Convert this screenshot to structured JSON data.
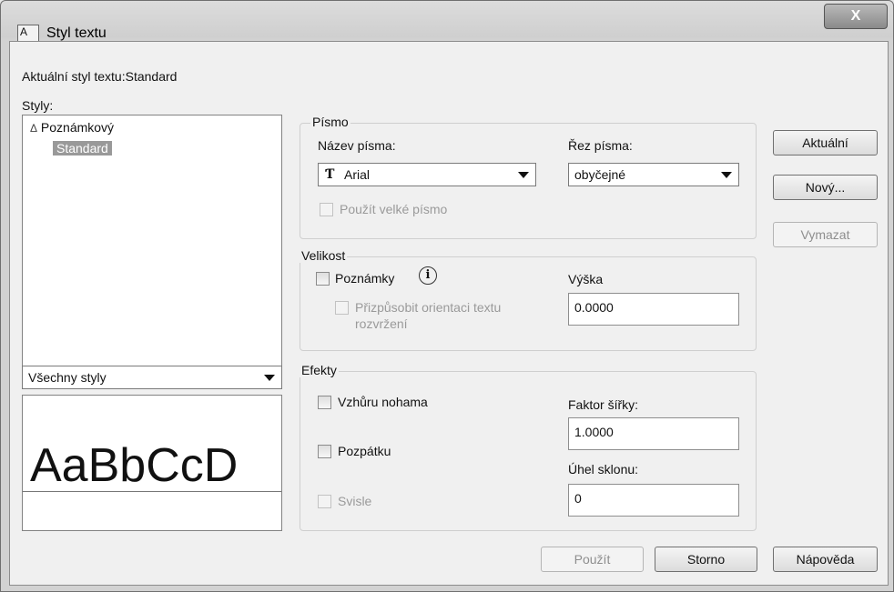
{
  "window": {
    "title": "Styl textu",
    "title_icon": "text-style-icon",
    "close_label": "X"
  },
  "current_style": {
    "label": "Aktuální styl textu:Standard"
  },
  "styles": {
    "label": "Styly:",
    "items": [
      {
        "icon": "annotative-icon",
        "icon_glyph": "Δ",
        "label": "Poznámkový",
        "selected": false
      },
      {
        "label": "Standard",
        "selected": true
      }
    ],
    "filter_value": "Všechny styly"
  },
  "preview": {
    "text": "AaBbCcD"
  },
  "font_group": {
    "title": "Písmo",
    "font_name_label": "Název písma:",
    "font_name_value": "Arial",
    "font_type_icon": "truetype-icon",
    "font_style_label": "Řez písma:",
    "font_style_value": "obyčejné",
    "big_font_label": "Použít velké písmo"
  },
  "size_group": {
    "title": "Velikost",
    "annotative_label": "Poznámky",
    "info_icon": "info-icon",
    "match_orientation_label_line1": "Přizpůsobit orientaci textu",
    "match_orientation_label_line2": "rozvržení",
    "height_label": "Výška",
    "height_value": "0.0000"
  },
  "effects_group": {
    "title": "Efekty",
    "upside_down_label": "Vzhůru nohama",
    "backwards_label": "Pozpátku",
    "vertical_label": "Svisle",
    "width_factor_label": "Faktor šířky:",
    "width_factor_value": "1.0000",
    "oblique_label": "Úhel sklonu:",
    "oblique_value": "0"
  },
  "buttons": {
    "set_current": "Aktuální",
    "new": "Nový...",
    "delete": "Vymazat",
    "apply": "Použít",
    "cancel": "Storno",
    "help": "Nápověda"
  }
}
